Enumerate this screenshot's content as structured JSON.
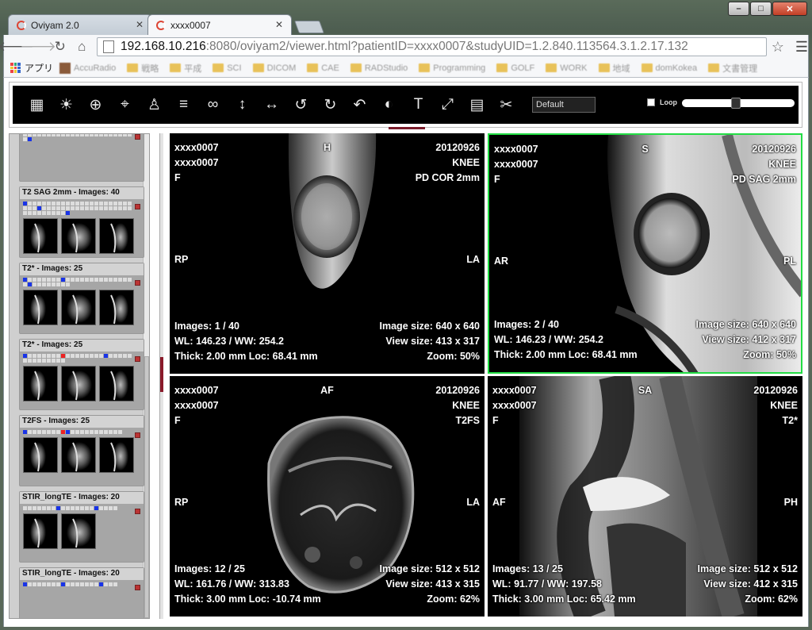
{
  "window": {
    "controls": [
      "–",
      "□",
      "✕"
    ]
  },
  "tabs": [
    {
      "title": "Oviyam 2.0",
      "active": false
    },
    {
      "title": "xxxx0007",
      "active": true
    }
  ],
  "address": {
    "host": "192.168.10.216",
    "rest": ":8080/oviyam2/viewer.html?patientID=xxxx0007&studyUID=1.2.840.113564.3.1.2.17.132"
  },
  "bookmarks": {
    "apps_label": "アプリ",
    "items": [
      "AccuRadio",
      "戦略",
      "平成",
      "SCI",
      "DICOM",
      "CAE",
      "RADStudio",
      "Programming",
      "GOLF",
      "WORK",
      "地域",
      "domKokea",
      "文書管理"
    ]
  },
  "viewer_toolbar": {
    "tools": [
      {
        "name": "layout-icon",
        "glyph": "▦"
      },
      {
        "name": "brightness-icon",
        "glyph": "☀"
      },
      {
        "name": "zoom-icon",
        "glyph": "⊕"
      },
      {
        "name": "move-icon",
        "glyph": "⌖"
      },
      {
        "name": "stamp-icon",
        "glyph": "♙"
      },
      {
        "name": "layers-icon",
        "glyph": "≡"
      },
      {
        "name": "link-icon",
        "glyph": "∞"
      },
      {
        "name": "scroll-vertical-icon",
        "glyph": "↕"
      },
      {
        "name": "scroll-horizontal-icon",
        "glyph": "↔"
      },
      {
        "name": "rotate-left-icon",
        "glyph": "↺"
      },
      {
        "name": "rotate-right-icon",
        "glyph": "↻"
      },
      {
        "name": "undo-icon",
        "glyph": "↶"
      },
      {
        "name": "invert-icon",
        "glyph": "◐"
      },
      {
        "name": "text-icon",
        "glyph": "T"
      },
      {
        "name": "fullscreen-icon",
        "glyph": "⤢"
      },
      {
        "name": "metadata-icon",
        "glyph": "▤"
      },
      {
        "name": "measure-icon",
        "glyph": "✂"
      }
    ],
    "preset": "Default",
    "loop_label": "Loop",
    "loop_checked": false,
    "slider_position": 0.48
  },
  "series": [
    {
      "title": "",
      "dots": "........................b",
      "thumbs": 0
    },
    {
      "title": "T2 SAG 2mm - Images: 40",
      "dots": "b.........................b............................b",
      "thumbs": 3
    },
    {
      "title": "T2* - Images: 25",
      "dots": "b.......b...............b........",
      "thumbs": 3
    },
    {
      "title": "T2* - Images: 25",
      "dots": "b.......r........b..............",
      "thumbs": 3
    },
    {
      "title": "T2FS - Images: 25",
      "dots": "b.......rb...........",
      "thumbs": 3
    },
    {
      "title": "STIR_longTE - Images: 20",
      "dots": ".......b.......b....",
      "thumbs": 2
    },
    {
      "title": "STIR_longTE - Images: 20",
      "dots": "b.......b.......b...",
      "thumbs": 0
    }
  ],
  "viewports": [
    {
      "selected": false,
      "patient_id": "xxxx0007",
      "patient_name": "xxxx0007",
      "sex": "F",
      "orient_top": "H",
      "orient_left": "RP",
      "orient_right": "LA",
      "date": "20120926",
      "body_part": "KNEE",
      "series_desc": "PD COR 2mm",
      "images": "Images: 1 / 40",
      "wl_ww": "WL: 146.23 / WW: 254.2",
      "thick_loc": "Thick: 2.00 mm Loc: 68.41 mm",
      "image_size": "Image size: 640 x 640",
      "view_size": "View size: 413 x 317",
      "zoom": "Zoom: 50%"
    },
    {
      "selected": true,
      "patient_id": "xxxx0007",
      "patient_name": "xxxx0007",
      "sex": "F",
      "orient_top": "S",
      "orient_left": "AR",
      "orient_right": "PL",
      "date": "20120926",
      "body_part": "KNEE",
      "series_desc": "PD SAG 2mm",
      "images": "Images: 2 / 40",
      "wl_ww": "WL: 146.23 / WW: 254.2",
      "thick_loc": "Thick: 2.00 mm Loc: 68.41 mm",
      "image_size": "Image size: 640 x 640",
      "view_size": "View size: 412 x 317",
      "zoom": "Zoom: 50%"
    },
    {
      "selected": false,
      "patient_id": "xxxx0007",
      "patient_name": "xxxx0007",
      "sex": "F",
      "orient_top": "AF",
      "orient_left": "RP",
      "orient_right": "LA",
      "date": "20120926",
      "body_part": "KNEE",
      "series_desc": "T2FS",
      "images": "Images: 12 / 25",
      "wl_ww": "WL: 161.76 / WW: 313.83",
      "thick_loc": "Thick: 3.00 mm Loc: -10.74 mm",
      "image_size": "Image size: 512 x 512",
      "view_size": "View size: 413 x 315",
      "zoom": "Zoom: 62%"
    },
    {
      "selected": false,
      "patient_id": "xxxx0007",
      "patient_name": "xxxx0007",
      "sex": "F",
      "orient_top": "SA",
      "orient_left": "AF",
      "orient_right": "PH",
      "date": "20120926",
      "body_part": "KNEE",
      "series_desc": "T2*",
      "images": "Images: 13 / 25",
      "wl_ww": "WL: 91.77 / WW: 197.58",
      "thick_loc": "Thick: 3.00 mm Loc: 65.42 mm",
      "image_size": "Image size: 512 x 512",
      "view_size": "View size: 412 x 315",
      "zoom": "Zoom: 62%"
    }
  ]
}
